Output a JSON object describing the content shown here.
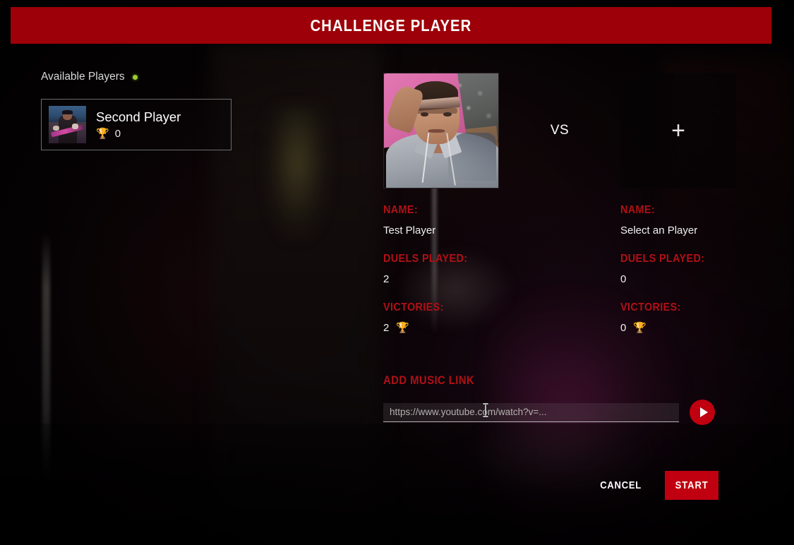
{
  "header": {
    "title": "CHALLENGE PLAYER",
    "bar_color": "#9d0008"
  },
  "sidebar": {
    "available_label": "Available Players",
    "online_dot_color": "#9acd32",
    "players": [
      {
        "name": "Second Player",
        "trophy_icon": "trophy-icon",
        "victories": "0",
        "avatar": "player-avatar-thumbnail"
      }
    ]
  },
  "duel": {
    "vs_label": "VS",
    "add_player_icon": "plus-icon",
    "left": {
      "avatar": "player-portrait-image",
      "name_label": "NAME:",
      "name_value": "Test Player",
      "duels_label": "DUELS PLAYED:",
      "duels_value": "2",
      "victories_label": "VICTORIES:",
      "victories_value": "2",
      "trophy_icon": "trophy-icon"
    },
    "right": {
      "avatar": "empty-player-slot",
      "name_label": "NAME:",
      "name_value": "Select an Player",
      "duels_label": "DUELS PLAYED:",
      "duels_value": "0",
      "victories_label": "VICTORIES:",
      "victories_value": "0",
      "trophy_icon": "trophy-icon"
    }
  },
  "music": {
    "label": "ADD MUSIC LINK",
    "input_value": "",
    "placeholder": "https://www.youtube.com/watch?v=...",
    "play_icon": "play-icon"
  },
  "actions": {
    "cancel_label": "CANCEL",
    "start_label": "START",
    "accent_color": "#c00010"
  },
  "icons": {
    "trophy": "🏆",
    "plus": "+"
  }
}
